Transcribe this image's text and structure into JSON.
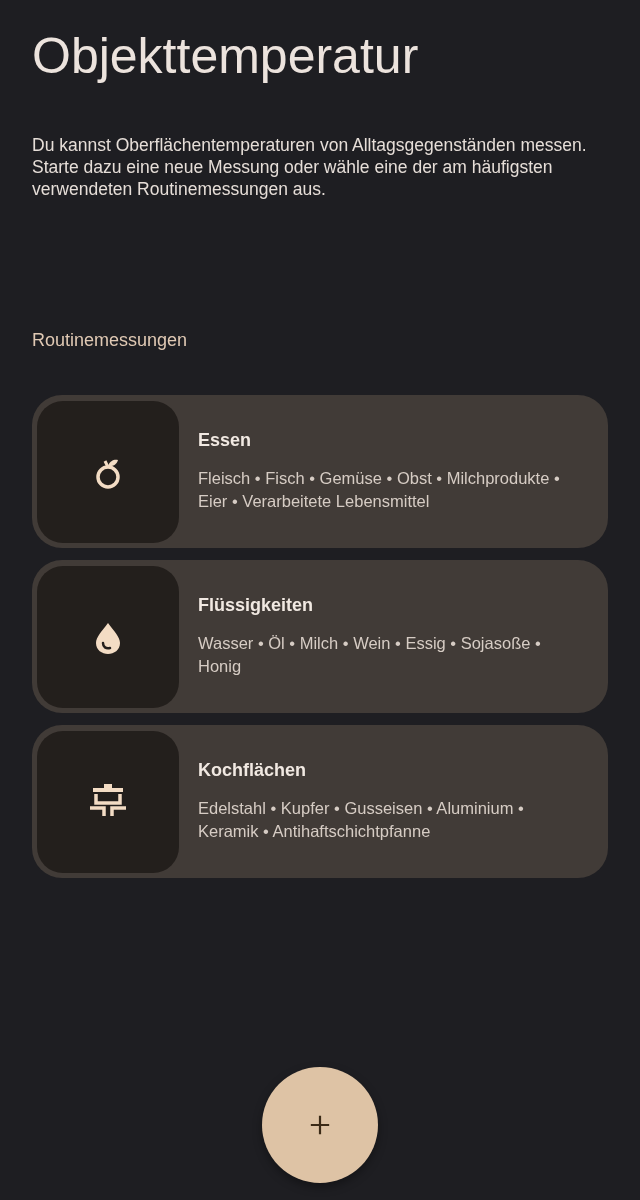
{
  "title": "Objekttemperatur",
  "description": "Du kannst Oberflächentemperaturen von Alltagsgegenständen messen. Starte dazu eine neue Messung oder wähle eine der am häufigsten verwendeten Routinemessungen aus.",
  "section_label": "Routinemessungen",
  "routines": [
    {
      "kind": "food",
      "title": "Essen",
      "items": "Fleisch • Fisch • Gemüse • Obst • Milchprodukte • Eier • Verarbeitete Lebensmittel"
    },
    {
      "kind": "liquid",
      "title": "Flüssigkeiten",
      "items": "Wasser • Öl • Milch • Wein • Essig • Sojasoße • Honig"
    },
    {
      "kind": "cooktop",
      "title": "Kochflächen",
      "items": "Edelstahl • Kupfer • Gusseisen • Aluminium • Keramik • Antihaftschichtpfanne"
    }
  ]
}
